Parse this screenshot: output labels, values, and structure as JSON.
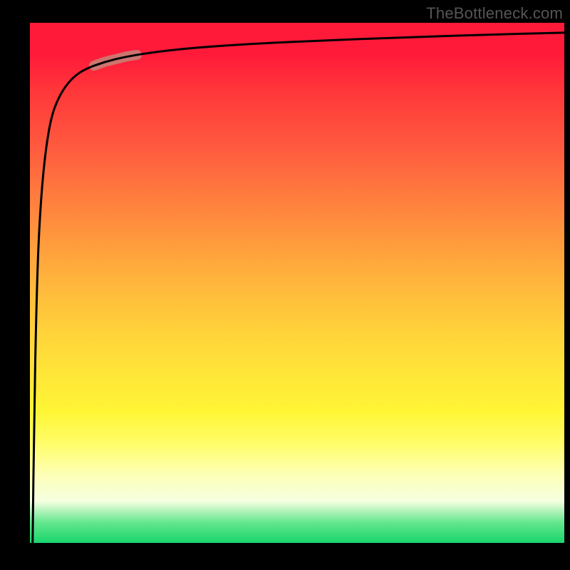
{
  "watermark": "TheBottleneck.com",
  "colors": {
    "gradient_top": "#ff1a3a",
    "gradient_mid_orange": "#ff9a3d",
    "gradient_mid_yellow": "#fff636",
    "gradient_bottom": "#18d56b",
    "curve": "#000000",
    "highlight": "#c78176",
    "background": "#000000"
  },
  "chart_data": {
    "type": "line",
    "title": "",
    "xlabel": "",
    "ylabel": "",
    "xlim": [
      0,
      100
    ],
    "ylim": [
      0,
      100
    ],
    "grid": false,
    "legend": false,
    "series": [
      {
        "name": "curve",
        "x": [
          0.5,
          0.8,
          1.2,
          1.6,
          2.2,
          3.0,
          4.0,
          5.5,
          7.5,
          10,
          14,
          18,
          24,
          32,
          42,
          55,
          70,
          85,
          100
        ],
        "y": [
          0,
          25,
          45,
          58,
          68,
          76,
          82,
          86,
          89,
          91,
          92.5,
          93.5,
          94.5,
          95.3,
          96,
          96.6,
          97.2,
          97.7,
          98.1
        ]
      }
    ],
    "highlight_range_x": [
      12,
      20
    ],
    "annotations": []
  }
}
